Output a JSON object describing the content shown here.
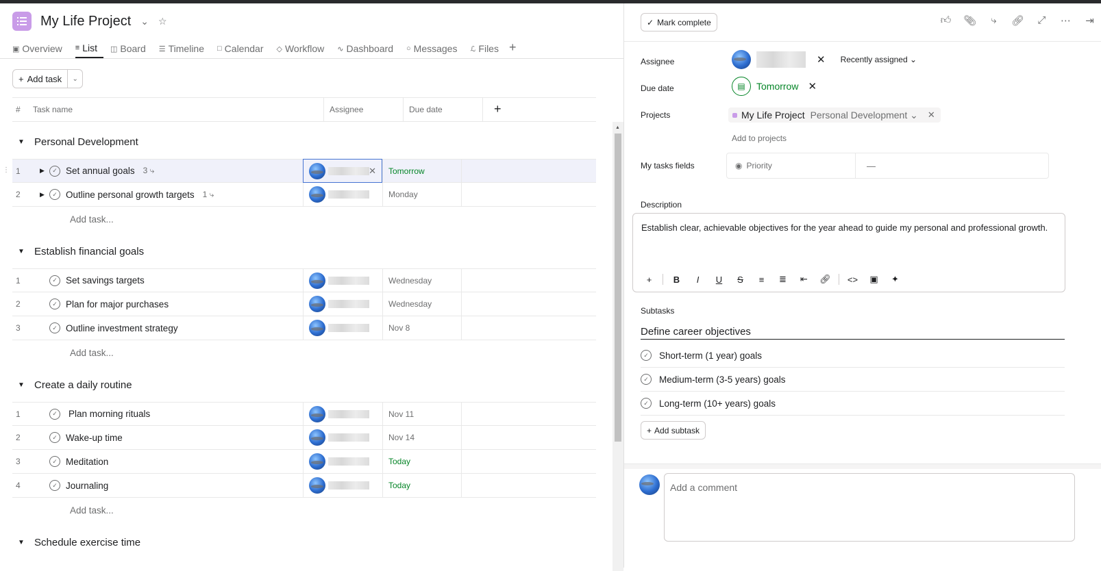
{
  "project": {
    "title": "My Life Project"
  },
  "tabs": [
    {
      "label": "Overview",
      "icon": "overview-icon"
    },
    {
      "label": "List",
      "icon": "list-icon",
      "active": true
    },
    {
      "label": "Board",
      "icon": "board-icon"
    },
    {
      "label": "Timeline",
      "icon": "timeline-icon"
    },
    {
      "label": "Calendar",
      "icon": "calendar-icon"
    },
    {
      "label": "Workflow",
      "icon": "workflow-icon"
    },
    {
      "label": "Dashboard",
      "icon": "dashboard-icon"
    },
    {
      "label": "Messages",
      "icon": "messages-icon"
    },
    {
      "label": "Files",
      "icon": "files-icon"
    }
  ],
  "toolbar": {
    "add_task": "Add task"
  },
  "table": {
    "headers": {
      "num": "#",
      "name": "Task name",
      "assignee": "Assignee",
      "due": "Due date"
    }
  },
  "sections": [
    {
      "title": "Personal Development",
      "tasks": [
        {
          "num": "1",
          "name": "Set annual goals",
          "subcount": "3",
          "due": "Tomorrow",
          "due_green": true,
          "selected": true
        },
        {
          "num": "2",
          "name": "Outline personal growth targets",
          "subcount": "1",
          "due": "Monday"
        }
      ],
      "add_label": "Add task..."
    },
    {
      "title": "Establish financial goals",
      "tasks": [
        {
          "num": "1",
          "name": "Set savings targets",
          "due": "Wednesday"
        },
        {
          "num": "2",
          "name": "Plan for major purchases",
          "due": "Wednesday"
        },
        {
          "num": "3",
          "name": "Outline investment strategy",
          "due": "Nov 8"
        }
      ],
      "add_label": "Add task..."
    },
    {
      "title": "Create a daily routine",
      "tasks": [
        {
          "num": "1",
          "name": "Plan morning rituals",
          "due": "Nov 11"
        },
        {
          "num": "2",
          "name": "Wake-up time",
          "due": "Nov 14"
        },
        {
          "num": "3",
          "name": "Meditation",
          "due": "Today",
          "due_green": true
        },
        {
          "num": "4",
          "name": "Journaling",
          "due": "Today",
          "due_green": true
        }
      ],
      "add_label": "Add task..."
    },
    {
      "title": "Schedule exercise time",
      "tasks": []
    }
  ],
  "detail": {
    "mark_complete": "Mark complete",
    "labels": {
      "assignee": "Assignee",
      "due": "Due date",
      "projects": "Projects",
      "my_tasks": "My tasks fields",
      "description": "Description",
      "subtasks": "Subtasks"
    },
    "recently_assigned": "Recently assigned",
    "due_value": "Tomorrow",
    "project_name": "My Life Project",
    "project_section": "Personal Development",
    "add_to_projects": "Add to projects",
    "priority_label": "Priority",
    "priority_value": "—",
    "description": "Establish clear, achievable objectives for the year ahead to guide my personal and professional growth.",
    "subtask_heading": "Define career objectives",
    "subtasks": [
      "Short-term (1 year) goals",
      "Medium-term (3-5 years) goals",
      "Long-term (10+ years) goals"
    ],
    "add_subtask": "Add subtask",
    "comment_placeholder": "Add a comment"
  },
  "colors": {
    "accent": "#c99ce8",
    "green": "#058527",
    "focus": "#4573d2"
  }
}
